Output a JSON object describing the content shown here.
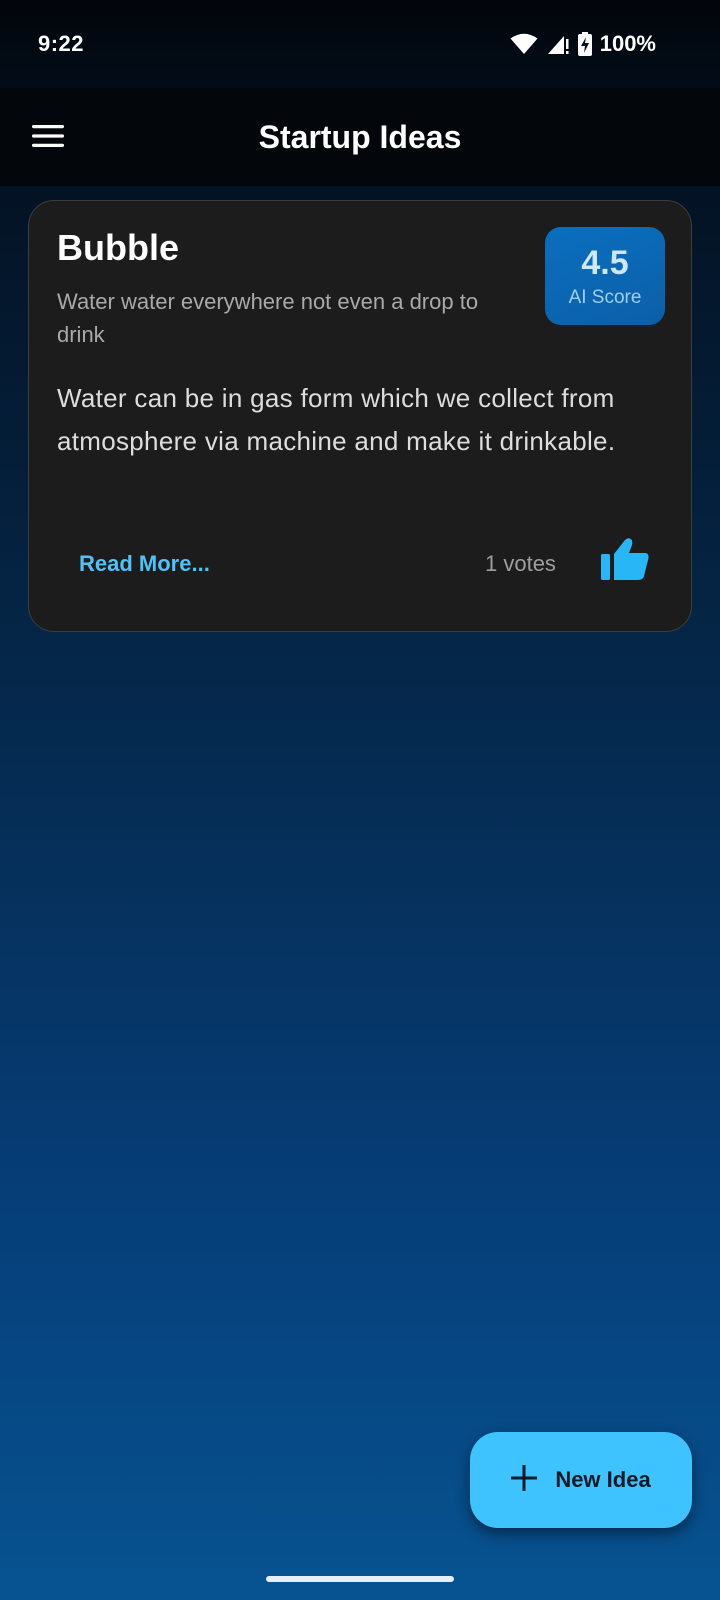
{
  "status_bar": {
    "time": "9:22",
    "battery": "100%",
    "icons": [
      "wifi-icon",
      "cellular-signal-icon",
      "battery-charging-icon"
    ]
  },
  "app_bar": {
    "title": "Startup Ideas",
    "menu_icon": "hamburger-menu-icon"
  },
  "ideas": [
    {
      "name": "Bubble",
      "tagline": "Water water everywhere not even a drop to drink",
      "ai_score": "4.5",
      "ai_score_label": "AI Score",
      "description": "Water can be in gas form which we collect from atmosphere via machine and make it drinkable.",
      "read_more_label": "Read More...",
      "votes_label": "1 votes",
      "like_icon": "thumbs-up-icon"
    }
  ],
  "fab": {
    "label": "New Idea",
    "icon": "plus-icon"
  },
  "colors": {
    "accent": "#4fc3f7",
    "fab_background": "#3ec3ff",
    "card_background": "#1c1c1c",
    "score_badge": "#0c5fa8",
    "app_bar_background": "#03070c"
  }
}
